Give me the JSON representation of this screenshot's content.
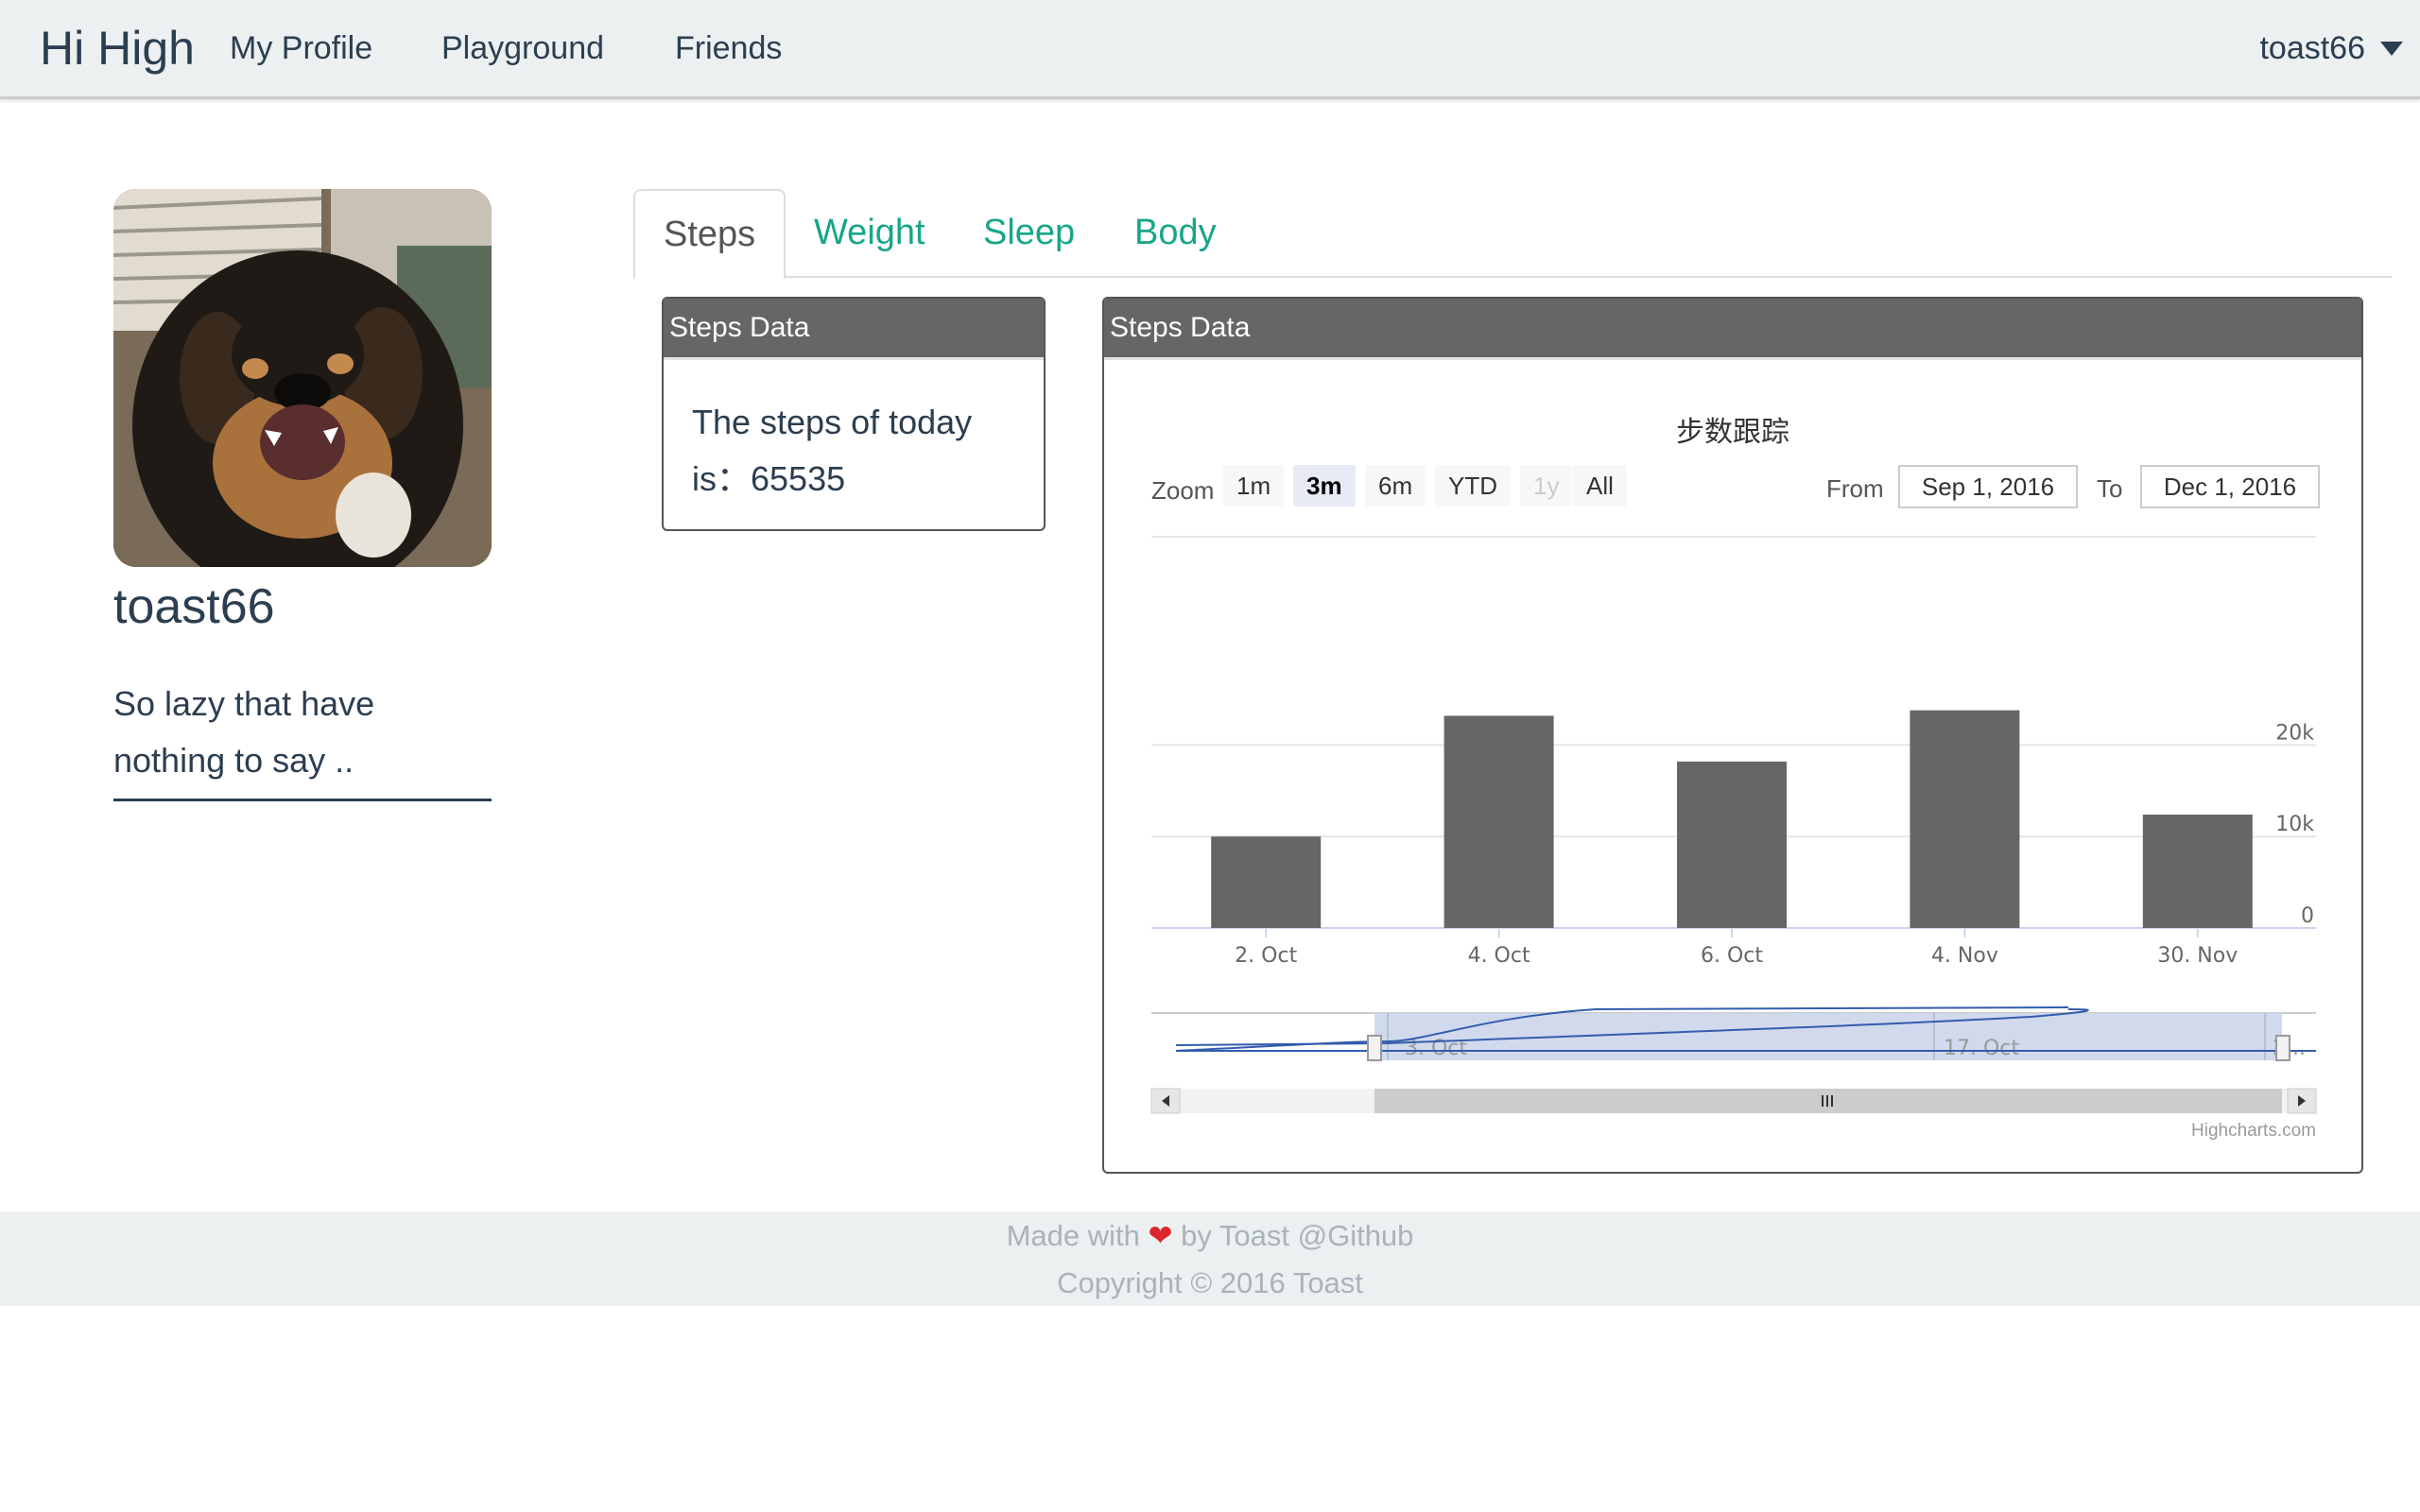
{
  "navbar": {
    "brand": "Hi High",
    "links": [
      "My Profile",
      "Playground",
      "Friends"
    ],
    "user": "toast66"
  },
  "profile": {
    "username": "toast66",
    "bio": "So lazy that have nothing to say .."
  },
  "tabs": [
    "Steps",
    "Weight",
    "Sleep",
    "Body"
  ],
  "today_panel": {
    "heading": "Steps Data",
    "text_prefix": "The steps of today is：",
    "steps": "65535"
  },
  "chart_panel": {
    "heading": "Steps Data",
    "zoom_label": "Zoom",
    "zoom_buttons": [
      "1m",
      "3m",
      "6m",
      "YTD",
      "1y",
      "All"
    ],
    "zoom_selected": "3m",
    "zoom_disabled": "1y",
    "from_label": "From",
    "from_value": "Sep 1, 2016",
    "to_label": "To",
    "to_value": "Dec 1, 2016",
    "credits": "Highcharts.com"
  },
  "chart_data": {
    "type": "bar",
    "title": "步数跟踪",
    "categories": [
      "2. Oct",
      "4. Oct",
      "6. Oct",
      "4. Nov",
      "30. Nov"
    ],
    "values": [
      10000,
      23200,
      18200,
      23800,
      12400
    ],
    "yticks": [
      "0",
      "10k",
      "20k"
    ],
    "ylim": [
      0,
      28000
    ],
    "navigator_labels": [
      "3. Oct",
      "17. Oct",
      "2..."
    ],
    "bar_color": "#666666"
  },
  "footer": {
    "line1_prefix": "Made with",
    "heart": "❤",
    "line1_suffix": "by Toast @Github",
    "line2": "Copyright © 2016 Toast"
  }
}
